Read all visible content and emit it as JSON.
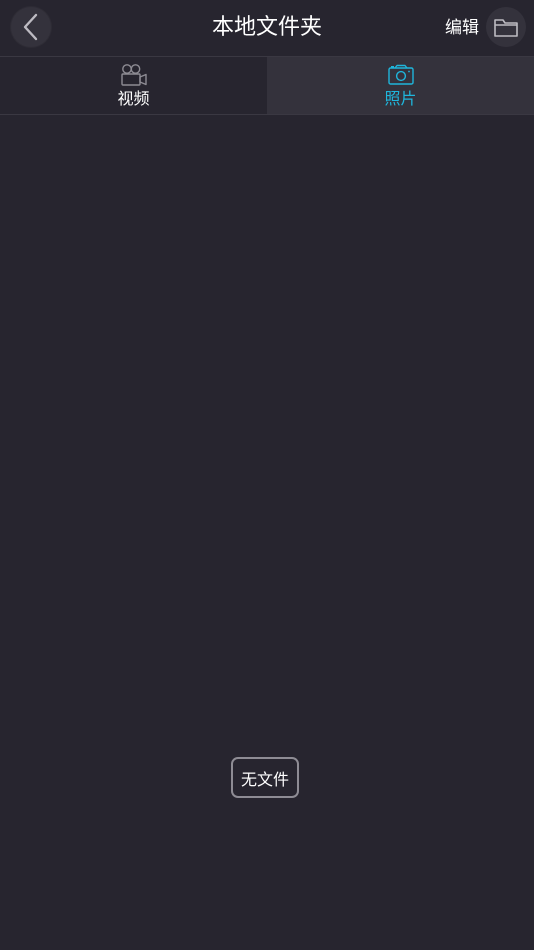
{
  "header": {
    "title": "本地文件夹",
    "edit_label": "编辑",
    "back_icon": "chevron-left-icon",
    "folder_icon": "folder-icon"
  },
  "tabs": [
    {
      "label": "视频",
      "icon": "video-camera-icon",
      "active": false
    },
    {
      "label": "照片",
      "icon": "camera-icon",
      "active": true
    }
  ],
  "empty_state": {
    "label": "无文件"
  },
  "colors": {
    "background": "#27252f",
    "panel": "#34323c",
    "accent": "#1fb6dc",
    "text": "#ffffff",
    "border": "#8e8c94"
  }
}
